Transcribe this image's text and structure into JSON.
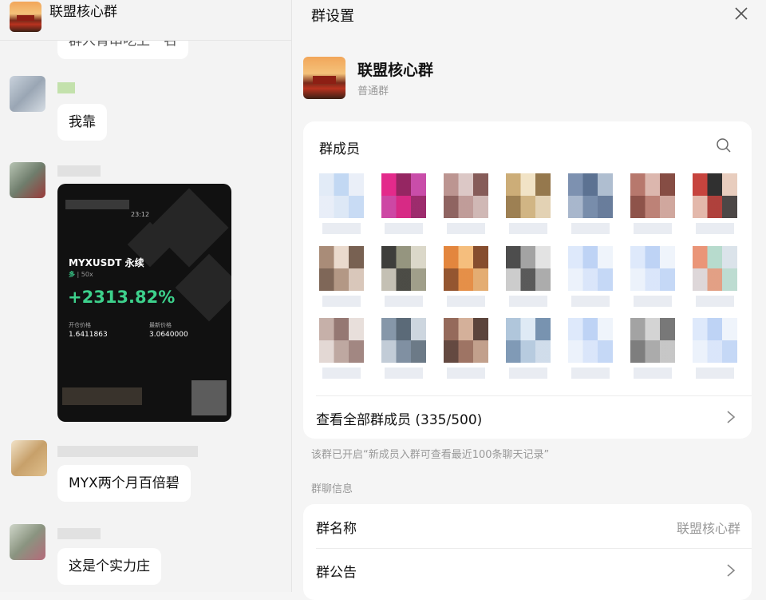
{
  "chat": {
    "group_name": "联盟核心群",
    "partial_message": "群人肯串吃上一名",
    "messages": [
      {
        "text": "我靠"
      },
      {
        "text": "MYX两个月百倍碧"
      },
      {
        "text": "这是个实力庄"
      }
    ],
    "trade_card": {
      "time": "23:12",
      "pair": "MYXUSDT 永续",
      "side": "多",
      "leverage": "50x",
      "pnl_pct": "+2313.82%",
      "entry_label": "开仓价格",
      "entry_value": "1.6411863",
      "last_label": "最新价格",
      "last_value": "3.0640000"
    }
  },
  "panel": {
    "title": "群设置",
    "close_icon": "close-icon",
    "group_name": "联盟核心群",
    "group_type": "普通群",
    "members_title": "群成员",
    "search_icon": "search-icon",
    "view_all_label": "查看全部群成员 (335/500)",
    "history_notice": "该群已开启“新成员入群可查看最近100条聊天记录”",
    "section_title": "群聊信息",
    "rows": [
      {
        "label": "群名称",
        "value": "联盟核心群"
      },
      {
        "label": "群公告",
        "value": ""
      }
    ],
    "accent_colors": {
      "text": "#111111",
      "muted": "#999999",
      "card": "#ffffff",
      "bg": "#f5f5f5"
    }
  }
}
